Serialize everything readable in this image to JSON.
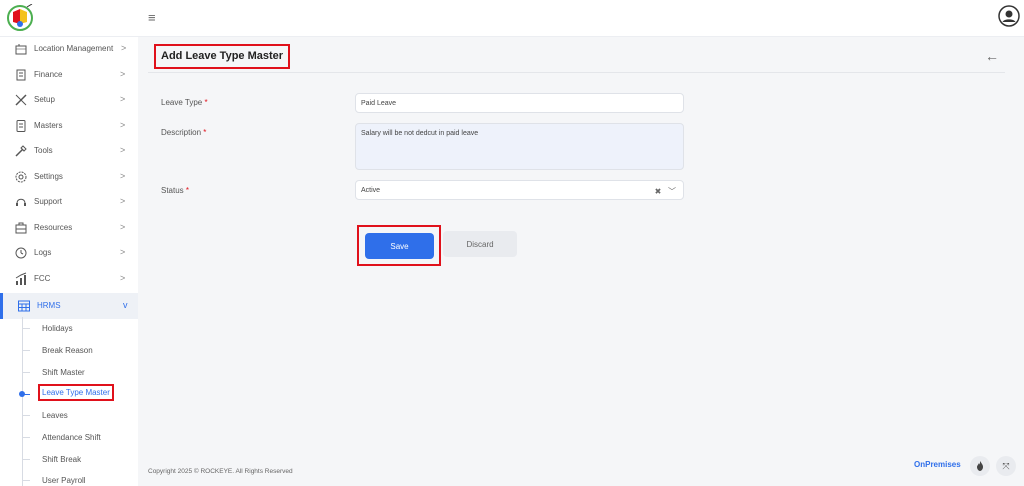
{
  "sidebar": {
    "items": [
      {
        "label": "Location Management",
        "icon": "location-icon",
        "chevron": ">"
      },
      {
        "label": "Finance",
        "icon": "finance-icon",
        "chevron": ">"
      },
      {
        "label": "Setup",
        "icon": "setup-icon",
        "chevron": ">"
      },
      {
        "label": "Masters",
        "icon": "masters-icon",
        "chevron": ">"
      },
      {
        "label": "Tools",
        "icon": "tools-icon",
        "chevron": ">"
      },
      {
        "label": "Settings",
        "icon": "settings-icon",
        "chevron": ">"
      },
      {
        "label": "Support",
        "icon": "support-icon",
        "chevron": ">"
      },
      {
        "label": "Resources",
        "icon": "resources-icon",
        "chevron": ">"
      },
      {
        "label": "Logs",
        "icon": "logs-icon",
        "chevron": ">"
      },
      {
        "label": "FCC",
        "icon": "fcc-icon",
        "chevron": ">"
      },
      {
        "label": "HRMS",
        "icon": "hrms-icon",
        "chevron": "v"
      }
    ],
    "sub_items": [
      "Holidays",
      "Break Reason",
      "Shift Master",
      "Leave Type Master",
      "Leaves",
      "Attendance Shift",
      "Shift Break",
      "User Payroll"
    ],
    "active_sub_item": "Leave Type Master"
  },
  "page": {
    "title": "Add Leave Type Master"
  },
  "form": {
    "leave_type_label": "Leave Type",
    "leave_type_value": "Paid Leave",
    "description_label": "Description",
    "description_value": "Salary will be not dedcut in paid leave",
    "status_label": "Status",
    "status_value": "Active",
    "required_marker": "*"
  },
  "buttons": {
    "save": "Save",
    "discard": "Discard"
  },
  "footer": {
    "copyright": "Copyright 2025 © ROCKEYE. All Rights Reserved",
    "mode": "OnPremises"
  },
  "colors": {
    "accent": "#2f6fea",
    "highlight": "#e0111b"
  }
}
